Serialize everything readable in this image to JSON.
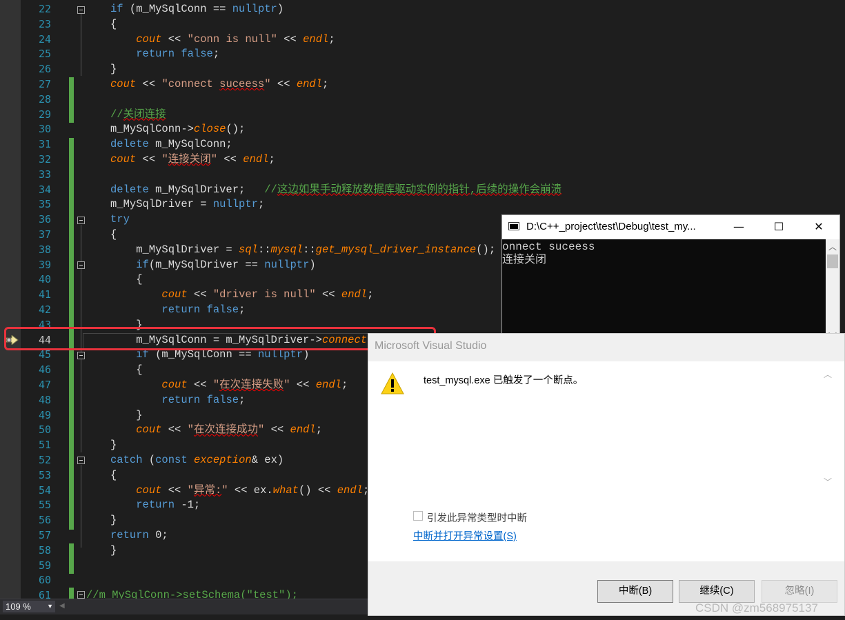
{
  "editor": {
    "zoom": "109 %",
    "current_line": 44,
    "lines": [
      {
        "no": "22",
        "html": "<span class='k'>if</span> (m_MySqlConn == <span class='k'>nullptr</span>)"
      },
      {
        "no": "23",
        "html": "{"
      },
      {
        "no": "24",
        "html": "    <span class='i'>cout</span> &lt;&lt; <span class='s'>\"conn is null\"</span> &lt;&lt; <span class='i'>endl</span>;"
      },
      {
        "no": "25",
        "html": "    <span class='k'>return</span> <span class='k'>false</span>;"
      },
      {
        "no": "26",
        "html": "}"
      },
      {
        "no": "27",
        "html": "<span class='i'>cout</span> &lt;&lt; <span class='s'>\"connect <span class='sq'>suceess</span>\"</span> &lt;&lt; <span class='i'>endl</span>;"
      },
      {
        "no": "28",
        "html": ""
      },
      {
        "no": "29",
        "html": "<span class='c'>//<span class='sq'>关闭连接</span></span>"
      },
      {
        "no": "30",
        "html": "m_MySqlConn-&gt;<span class='i'>close</span>();"
      },
      {
        "no": "31",
        "html": "<span class='k'>delete</span> m_MySqlConn;"
      },
      {
        "no": "32",
        "html": "<span class='i'>cout</span> &lt;&lt; <span class='s'>\"<span class='sq'>连接关闭</span>\"</span> &lt;&lt; <span class='i'>endl</span>;"
      },
      {
        "no": "33",
        "html": ""
      },
      {
        "no": "34",
        "html": "<span class='k'>delete</span> m_MySqlDriver;   <span class='c'>//<span class='sq'>这边如果手动释放数据库驱动实例的指针,后续的操作会崩溃</span></span>"
      },
      {
        "no": "35",
        "html": "m_MySqlDriver = <span class='k'>nullptr</span>;"
      },
      {
        "no": "36",
        "html": "<span class='k'>try</span>"
      },
      {
        "no": "37",
        "html": "{"
      },
      {
        "no": "38",
        "html": "    m_MySqlDriver = <span class='i'>sql</span>::<span class='i'>mysql</span>::<span class='i'>get_mysql_driver_instance</span>();"
      },
      {
        "no": "39",
        "html": "    <span class='k'>if</span>(m_MySqlDriver == <span class='k'>nullptr</span>)"
      },
      {
        "no": "40",
        "html": "    {"
      },
      {
        "no": "41",
        "html": "        <span class='i'>cout</span> &lt;&lt; <span class='s'>\"driver is null\"</span> &lt;&lt; <span class='i'>endl</span>;"
      },
      {
        "no": "42",
        "html": "        <span class='k'>return</span> <span class='k'>false</span>;"
      },
      {
        "no": "43",
        "html": "    }"
      },
      {
        "no": "44",
        "html": "    m_MySqlConn = m_MySqlDriver-&gt;<span class='i'>connect</span>(\""
      },
      {
        "no": "45",
        "html": "    <span class='k'>if</span> (m_MySqlConn == <span class='k'>nullptr</span>)"
      },
      {
        "no": "46",
        "html": "    {"
      },
      {
        "no": "47",
        "html": "        <span class='i'>cout</span> &lt;&lt; <span class='s'>\"<span class='sq'>在次连接失败</span>\"</span> &lt;&lt; <span class='i'>endl</span>;"
      },
      {
        "no": "48",
        "html": "        <span class='k'>return</span> <span class='k'>false</span>;"
      },
      {
        "no": "49",
        "html": "    }"
      },
      {
        "no": "50",
        "html": "    <span class='i'>cout</span> &lt;&lt; <span class='s'>\"<span class='sq'>在次连接成功</span>\"</span> &lt;&lt; <span class='i'>endl</span>;"
      },
      {
        "no": "51",
        "html": "}"
      },
      {
        "no": "52",
        "html": "<span class='k'>catch</span> (<span class='k'>const</span> <span class='i'>exception</span>&amp; ex)"
      },
      {
        "no": "53",
        "html": "{"
      },
      {
        "no": "54",
        "html": "    <span class='i'>cout</span> &lt;&lt; <span class='s'>\"<span class='sq'>异常:</span>\"</span> &lt;&lt; ex.<span class='i'>what</span>() &lt;&lt; <span class='i'>endl</span>;"
      },
      {
        "no": "55",
        "html": "    <span class='k'>return</span> -1;"
      },
      {
        "no": "56",
        "html": "}"
      },
      {
        "no": "57",
        "html": "<span class='k'>return</span> 0;"
      },
      {
        "no": "58",
        "html": "}"
      },
      {
        "no": "59",
        "html": ""
      },
      {
        "no": "60",
        "html": ""
      },
      {
        "no": "61",
        "html": "<span class='c'>//m_MySqlConn-&gt;setSchema(\"test\");</span>"
      }
    ]
  },
  "console": {
    "title": "D:\\C++_project\\test\\Debug\\test_my...",
    "output": [
      "onnect suceess",
      "连接关闭"
    ],
    "minimize_glyph": "—",
    "maximize_glyph": "☐",
    "close_glyph": "✕"
  },
  "dialog": {
    "title": "Microsoft Visual Studio",
    "message": "test_mysql.exe 已触发了一个断点。",
    "checkbox_label": "引发此异常类型时中断",
    "link_text": "中断并打开异常设置(S)",
    "buttons": {
      "break": "中断(B)",
      "continue": "继续(C)",
      "ignore": "忽略(I)"
    }
  },
  "watermark": "CSDN @zm568975137",
  "colors": {
    "accent_red": "#e8323c",
    "change_bar": "#57a64a",
    "line_number": "#2b91af"
  }
}
